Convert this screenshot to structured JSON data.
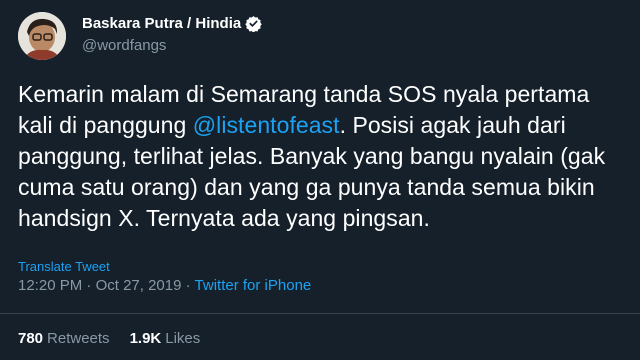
{
  "author": {
    "display_name": "Baskara Putra / Hindia",
    "handle": "@wordfangs",
    "verified_icon": "verified-badge-icon"
  },
  "tweet": {
    "text_before": "Kemarin malam di Semarang tanda SOS nyala pertama kali di panggung ",
    "mention": "@listentofeast",
    "text_after": ". Posisi agak jauh dari panggung, terlihat jelas. Banyak yang bangu nyalain (gak cuma satu orang) dan yang ga punya tanda semua bikin handsign X. Ternyata ada yang pingsan."
  },
  "translate_label": "Translate Tweet",
  "meta": {
    "time": "12:20 PM",
    "separator": " · ",
    "date": "Oct 27, 2019",
    "source": "Twitter for iPhone"
  },
  "stats": {
    "retweets_count": "780",
    "retweets_label": "Retweets",
    "likes_count": "1.9K",
    "likes_label": "Likes"
  },
  "colors": {
    "background": "#15202b",
    "accent": "#1da1f2",
    "secondary_text": "#8899a6",
    "divider": "#38444d"
  }
}
